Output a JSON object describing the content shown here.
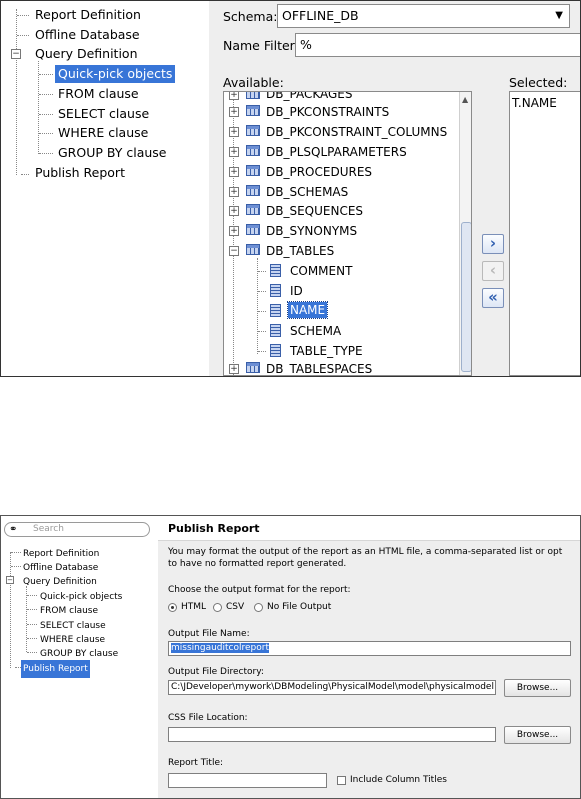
{
  "top": {
    "nav_items": [
      {
        "label": "Report Definition"
      },
      {
        "label": "Offline Database"
      },
      {
        "label": "Query Definition"
      },
      {
        "label": "Quick-pick objects"
      },
      {
        "label": "FROM clause"
      },
      {
        "label": "SELECT clause"
      },
      {
        "label": "WHERE clause"
      },
      {
        "label": "GROUP BY clause"
      },
      {
        "label": "Publish Report"
      }
    ],
    "schema_label": "Schema:",
    "schema_value": "OFFLINE_DB",
    "name_filter_label": "Name Filter:",
    "name_filter_value": "%",
    "available_label": "Available:",
    "selected_label": "Selected:",
    "available_items": [
      {
        "label": "DB_PACKAGES"
      },
      {
        "label": "DB_PKCONSTRAINTS"
      },
      {
        "label": "DB_PKCONSTRAINT_COLUMNS"
      },
      {
        "label": "DB_PLSQLPARAMETERS"
      },
      {
        "label": "DB_PROCEDURES"
      },
      {
        "label": "DB_SCHEMAS"
      },
      {
        "label": "DB_SEQUENCES"
      },
      {
        "label": "DB_SYNONYMS"
      },
      {
        "label": "DB_TABLES"
      },
      {
        "label": "COMMENT"
      },
      {
        "label": "ID"
      },
      {
        "label": "NAME"
      },
      {
        "label": "SCHEMA"
      },
      {
        "label": "TABLE_TYPE"
      },
      {
        "label": "DB_TABLESPACES"
      }
    ],
    "selected_items": [
      {
        "label": "T.NAME"
      }
    ],
    "move_right": "›",
    "move_left": "‹",
    "move_all_left": "«"
  },
  "bottom": {
    "search_placeholder": "Search",
    "nav_items": [
      {
        "label": "Report Definition"
      },
      {
        "label": "Offline Database"
      },
      {
        "label": "Query Definition"
      },
      {
        "label": "Quick-pick objects"
      },
      {
        "label": "FROM clause"
      },
      {
        "label": "SELECT clause"
      },
      {
        "label": "WHERE clause"
      },
      {
        "label": "GROUP BY clause"
      },
      {
        "label": "Publish Report"
      }
    ],
    "title": "Publish Report",
    "description": "You may format the output of the report as an HTML file, a comma-separated list or opt to have no formatted report generated.",
    "format_prompt": "Choose the output format for the report:",
    "formats": [
      {
        "label": "HTML"
      },
      {
        "label": "CSV"
      },
      {
        "label": "No File Output"
      }
    ],
    "output_file_name_label": "Output File Name:",
    "output_file_name_value": "missingauditcolreport",
    "output_dir_label": "Output File Directory:",
    "output_dir_value": "C:\\JDeveloper\\mywork\\DBModeling\\PhysicalModel\\model\\physicalmodel",
    "browse_label": "Browse...",
    "css_label": "CSS File Location:",
    "css_value": "",
    "report_title_label": "Report Title:",
    "report_title_value": "",
    "include_titles_label": "Include Column Titles"
  }
}
